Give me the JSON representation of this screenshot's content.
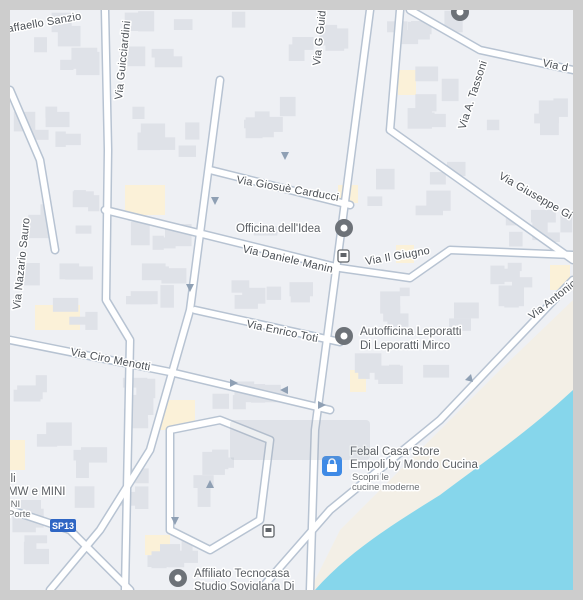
{
  "map": {
    "colors": {
      "background": "#eef0f4",
      "block": "#dfe2e8",
      "road": "#ffffff",
      "road_casing": "#b7c3d2",
      "river": "#86d6eb",
      "sand": "#f3efe6",
      "landuse": "#fbf1d8",
      "poi_pin": "#6d7278",
      "shop_pin": "#3e8ae6"
    },
    "streets": {
      "raffaello_sanzio": "affaello Sanzio",
      "guicciardini": "Via Guicciardini",
      "via_g_guidi": "Via G Guid",
      "via_a_tassoni": "Via A. Tassoni",
      "via_top_right": "Via d",
      "carducci": "Via Giosuè Carducci",
      "giuseppe_gi": "Via Giuseppe Gi",
      "nazario_sauro": "Via Nazario Sauro",
      "daniele_manin": "Via Daniele Manin",
      "il_giugno": "Via Il Giugno",
      "antonio": "Via Antonio",
      "enrico_toti": "Via Enrico Toti",
      "ciro_menotti": "Via Ciro Menotti",
      "sp13": "SP13"
    },
    "pois": {
      "officina": "Officina dell'Idea",
      "autofficina_1": "Autofficina Leporatti",
      "autofficina_2": "Di Leporatti Mirco",
      "febal_1": "Febal Casa Store",
      "febal_2": "Empoli by Mondo Cucina",
      "febal_sub_1": "Scopri le",
      "febal_sub_2": "cucine moderne",
      "affiliato_1": "Affiliato Tecnocasa",
      "affiliato_2": "Studio Soviglana Di",
      "bmw_1": "lli",
      "bmw_2": "MW e MINI",
      "bmw_3": "INI",
      "porte": "Porte"
    },
    "icons": [
      "place-pin-icon",
      "shopping-bag-icon",
      "bus-stop-icon"
    ]
  }
}
